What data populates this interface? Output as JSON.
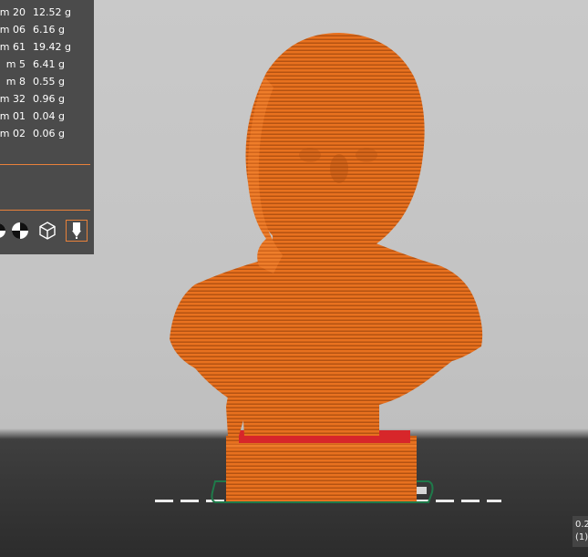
{
  "filament_stats": [
    {
      "length": "20 m",
      "weight": "12.52 g"
    },
    {
      "length": "06 m",
      "weight": "6.16 g"
    },
    {
      "length": "61 m",
      "weight": "19.42 g"
    },
    {
      "length": "5 m",
      "weight": "6.41 g"
    },
    {
      "length": "8 m",
      "weight": "0.55 g"
    },
    {
      "length": "32 m",
      "weight": "0.96 g"
    },
    {
      "length": "01 m",
      "weight": "0.04 g"
    },
    {
      "length": "02 m",
      "weight": "0.06 g"
    }
  ],
  "toolbar_icons": [
    "view-cube-icon",
    "color-wheel-icon",
    "isometric-cube-icon",
    "nozzle-icon"
  ],
  "coords": {
    "line1": "0.2",
    "line2": "(1)"
  },
  "colors": {
    "model_orange": "#e8711f",
    "model_stripe": "#b34e0d",
    "support_red": "#d7262a",
    "skirt_green": "#1f7a4a",
    "panel_bg": "#4b4b4b",
    "accent": "#e8813a"
  }
}
